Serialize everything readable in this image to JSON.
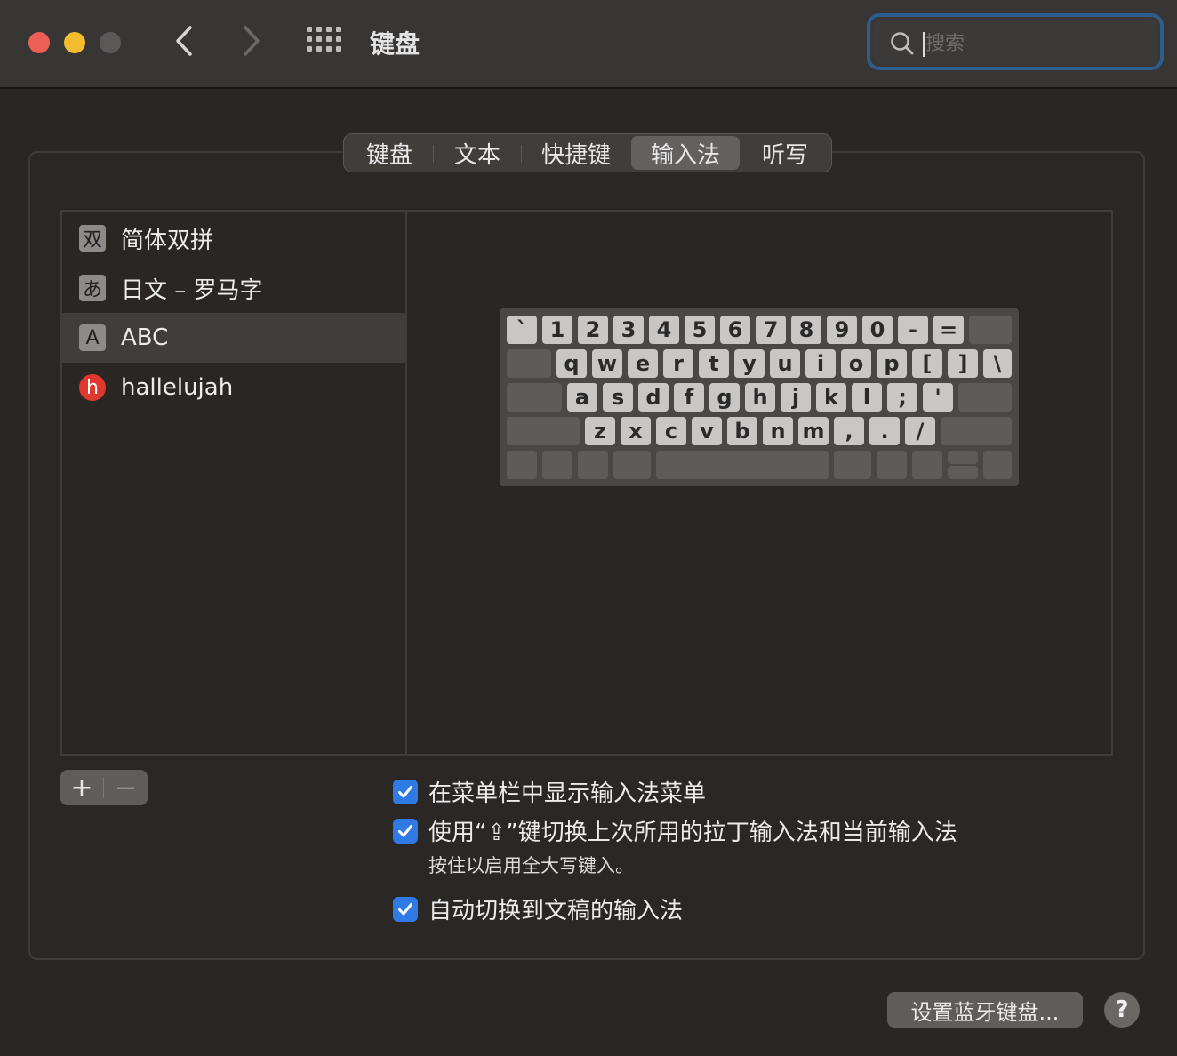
{
  "window": {
    "title": "键盘"
  },
  "search": {
    "placeholder": "搜索",
    "value": ""
  },
  "tabs": [
    {
      "label": "键盘",
      "active": false
    },
    {
      "label": "文本",
      "active": false
    },
    {
      "label": "快捷键",
      "active": false
    },
    {
      "label": "输入法",
      "active": true
    },
    {
      "label": "听写",
      "active": false
    }
  ],
  "input_sources": [
    {
      "icon_text": "双",
      "label": "简体双拼",
      "icon": "shuang-pin-icon",
      "selected": false
    },
    {
      "icon_text": "あ",
      "label": "日文 – 罗马字",
      "icon": "japanese-romaji-icon",
      "selected": false
    },
    {
      "icon_text": "A",
      "label": "ABC",
      "icon": "abc-icon",
      "selected": true
    },
    {
      "icon_text": "h",
      "label": "hallelujah",
      "icon": "hallelujah-icon",
      "selected": false
    }
  ],
  "keyboard": {
    "row1": [
      "`",
      "1",
      "2",
      "3",
      "4",
      "5",
      "6",
      "7",
      "8",
      "9",
      "0",
      "-",
      "="
    ],
    "row2": [
      "q",
      "w",
      "e",
      "r",
      "t",
      "y",
      "u",
      "i",
      "o",
      "p",
      "[",
      "]",
      "\\"
    ],
    "row3": [
      "a",
      "s",
      "d",
      "f",
      "g",
      "h",
      "j",
      "k",
      "l",
      ";",
      "'"
    ],
    "row4": [
      "z",
      "x",
      "c",
      "v",
      "b",
      "n",
      "m",
      ",",
      ".",
      "/"
    ]
  },
  "add_remove": {
    "add": "+",
    "remove": "−"
  },
  "options": [
    {
      "label": "在菜单栏中显示输入法菜单",
      "checked": true
    },
    {
      "label": "使用“⇪”键切换上次所用的拉丁输入法和当前输入法",
      "checked": true,
      "sublabel": "按住以启用全大写键入。"
    },
    {
      "label": "自动切换到文稿的输入法",
      "checked": true
    }
  ],
  "buttons": {
    "bluetooth": "设置蓝牙键盘...",
    "help": "?"
  },
  "colors": {
    "accent": "#2f7ae5",
    "close": "#ed5f56",
    "minimize": "#f4bd2f",
    "hallelujah_red": "#e0382e",
    "search_focus": "#2c5d8c"
  }
}
